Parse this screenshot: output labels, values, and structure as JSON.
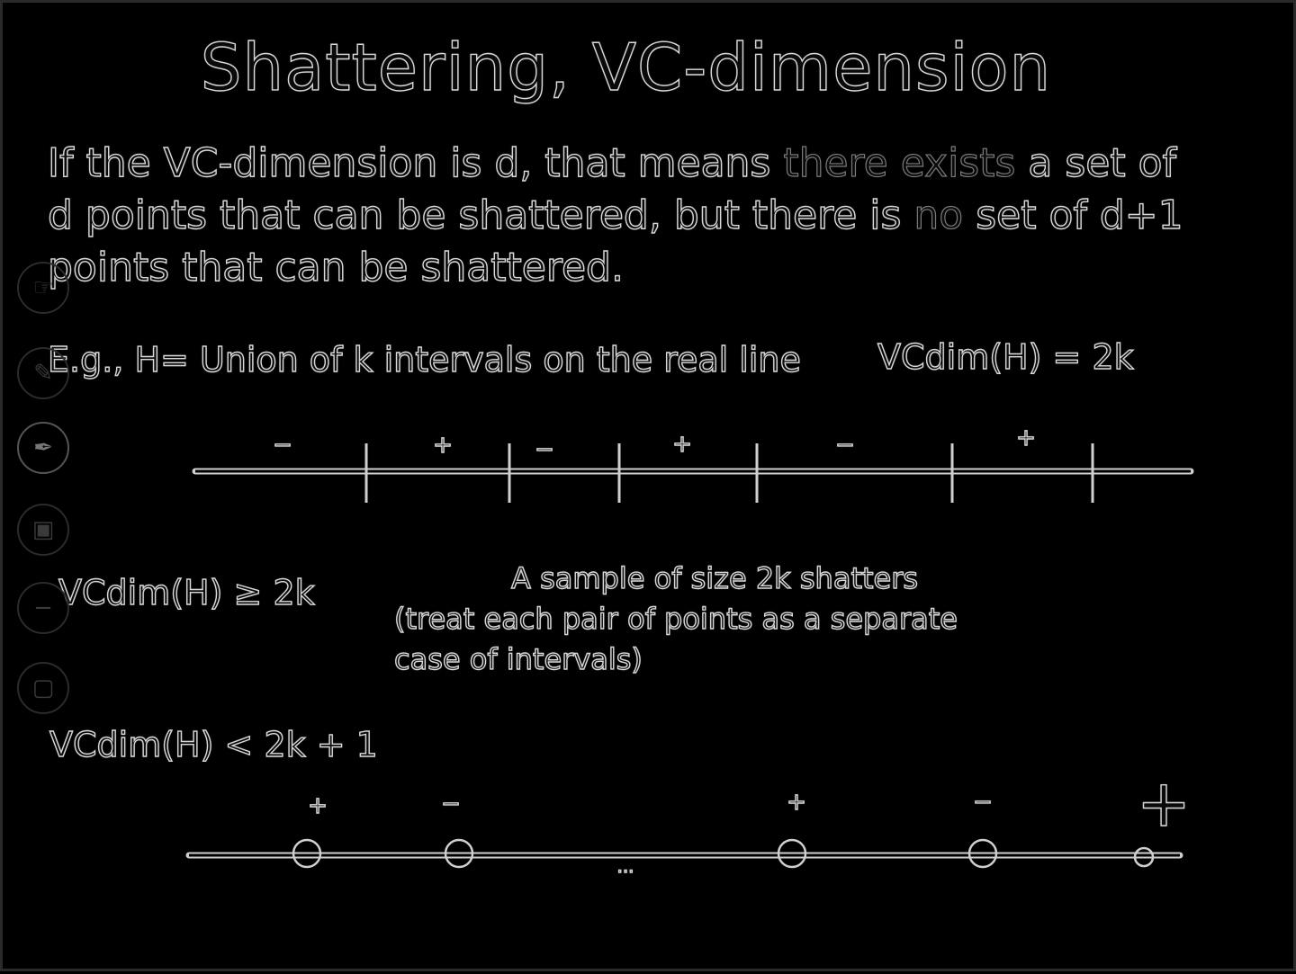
{
  "slide": {
    "title": "Shattering, VC-dimension",
    "definition": {
      "line1": {
        "a": "If the VC-dimension is d, that means ",
        "b": "there exists",
        "c": " a set of"
      },
      "line2": {
        "a": "d points that can be shattered, but there is ",
        "b": "no",
        "c": " set of d+1"
      },
      "line3": "points that can be shattered."
    },
    "example": "E.g., H= Union of k intervals on the real line",
    "vc_equals": "VCdim(H) = 2k",
    "vc_geq": "VCdim(H) ≥ 2k",
    "sample_note": {
      "line1": "A sample of size 2k shatters",
      "line2": "(treat each pair of points as a separate",
      "line3": "case of intervals)"
    },
    "vc_lt": "VCdim(H) < 2k + 1",
    "top_line_labels": [
      "−",
      "+",
      "−",
      "+",
      "−",
      "+"
    ],
    "bottom_line_labels": [
      "+",
      "−",
      "+",
      "−",
      "+"
    ],
    "bottom_dots": "..."
  },
  "side_toolbar": {
    "icons": [
      "pointer-icon",
      "pen-icon",
      "highlighter-icon",
      "eraser-icon",
      "zoom-out-icon",
      "screen-icon"
    ]
  },
  "colors": {
    "background": "#000000",
    "outline": "#d8d8d8",
    "dim_outline": "#7a7a7a"
  }
}
